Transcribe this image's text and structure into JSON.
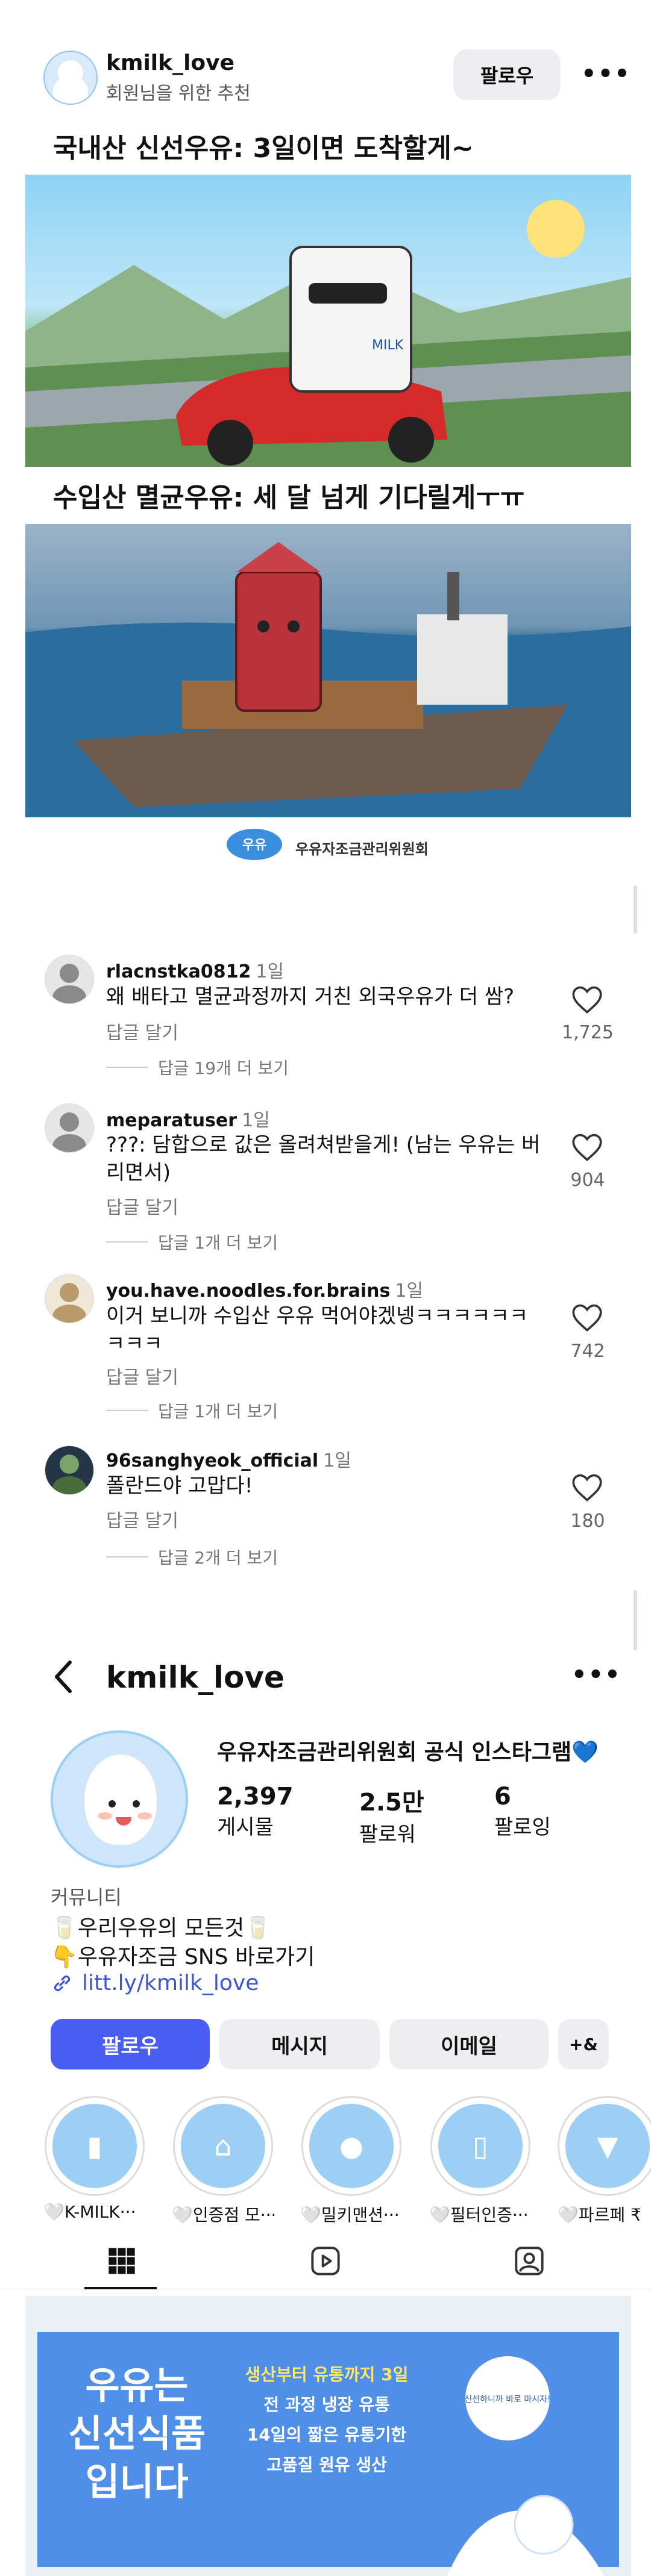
{
  "post": {
    "username": "kmilk_love",
    "subtitle": "회원님을 위한 추천",
    "follow_label": "팔로우",
    "more_label": "•••",
    "title1": "국내산 신선우유: 3일이면 도착할게~",
    "title2": "수입산 멸균우유: 세 달 넘게 기다릴게ㅜㅠ",
    "brand_logo_text": "우유",
    "brand_name": "우유자조금관리위원회",
    "milk_carton_text": "MILK"
  },
  "comments": [
    {
      "user": "rlacnstka0812",
      "time": "1일",
      "text": "왜 배타고 멸균과정까지 거친 외국우유가 더 쌈?",
      "reply": "답글 달기",
      "more": "답글 19개 더 보기",
      "likes": "1,725"
    },
    {
      "user": "meparatuser",
      "time": "1일",
      "text": "???: 담합으로 값은 올려쳐받을게! (남는 우유는 버리면서)",
      "reply": "답글 달기",
      "more": "답글 1개 더 보기",
      "likes": "904"
    },
    {
      "user": "you.have.noodles.for.brains",
      "time": "1일",
      "text": "이거 보니까 수입산 우유 먹어야겠넹ㅋㅋㅋㅋㅋㅋㅋㅋㅋ",
      "reply": "답글 달기",
      "more": "답글 1개 더 보기",
      "likes": "742"
    },
    {
      "user": "96sanghyeok_official",
      "time": "1일",
      "text": "폴란드야 고맙다!",
      "reply": "답글 달기",
      "more": "답글 2개 더 보기",
      "likes": "180"
    }
  ],
  "profile": {
    "username": "kmilk_love",
    "more_label": "•••",
    "name": "우유자조금관리위원회 공식 인스타그램💙",
    "stats": [
      {
        "num": "2,397",
        "label": "게시물"
      },
      {
        "num": "2.5만",
        "label": "팔로워"
      },
      {
        "num": "6",
        "label": "팔로잉"
      }
    ],
    "category": "커뮤니티",
    "bio_line1": "🥛우리우유의 모든것🥛",
    "bio_line2": "👇우유자조금 SNS 바로가기",
    "link": "litt.ly/kmilk_love",
    "buttons": {
      "follow": "팔로우",
      "message": "메시지",
      "email": "이메일",
      "add_person": "+&"
    },
    "highlights": [
      {
        "label": "🤍K-MILK···",
        "icon": "milk-carton-icon"
      },
      {
        "label": "🤍인증점 모···",
        "icon": "store-icon"
      },
      {
        "label": "🤍밀키맨션···",
        "icon": "drop-icon"
      },
      {
        "label": "🤍필터인증···",
        "icon": "phone-icon"
      },
      {
        "label": "🤍파르페 ₹",
        "icon": "parfait-icon"
      }
    ]
  },
  "grid_post": {
    "headline_lines": [
      "우유는",
      "신선식품",
      "입니다"
    ],
    "info_lines": [
      "생산부터 유통까지 3일",
      "전 과정 냉장 유통",
      "14일의 짧은 유통기한",
      "고품질 원유 생산"
    ],
    "bubble_text": "신선하니까 바로 마시자!"
  },
  "colors": {
    "accent": "#4a5df2",
    "link": "#3a56d6",
    "grid_bg": "#4f8fe8"
  }
}
